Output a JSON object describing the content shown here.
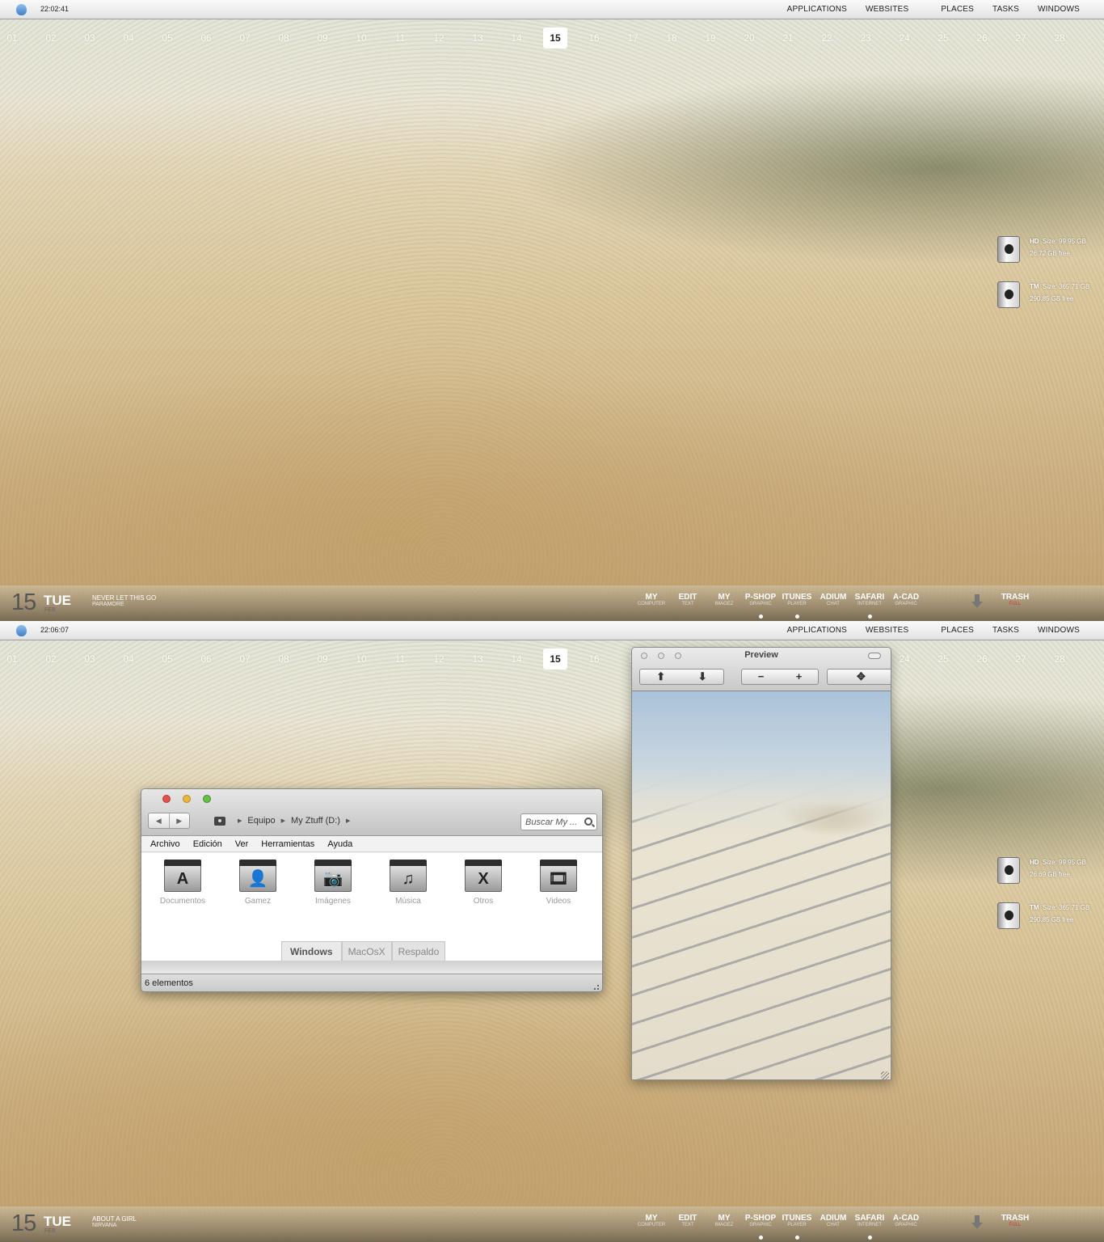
{
  "screens": [
    {
      "clock": "22:02:41",
      "drives": [
        {
          "name": "HD",
          "line1": "Size: 99.95 GB",
          "line2": "26.72 GB free"
        },
        {
          "name": "TM",
          "line1": "Size: 365.71 GB",
          "line2": "290.85 GB free"
        }
      ],
      "now_playing": {
        "song": "NEVER LET THIS GO",
        "artist": "PARAMORE"
      }
    },
    {
      "clock": "22:06:07",
      "drives": [
        {
          "name": "HD",
          "line1": "Size: 99.95 GB",
          "line2": "26.69 GB free"
        },
        {
          "name": "TM",
          "line1": "Size: 365.71 GB",
          "line2": "290.85 GB free"
        }
      ],
      "now_playing": {
        "song": "ABOUT A GIRL",
        "artist": "NIRVANA"
      }
    }
  ],
  "menu": [
    "APPLICATIONS",
    "WEBSITES",
    "PLACES",
    "TASKS",
    "WINDOWS"
  ],
  "days": [
    "01",
    "02",
    "03",
    "04",
    "05",
    "06",
    "07",
    "08",
    "09",
    "10",
    "11",
    "12",
    "13",
    "14",
    "15",
    "16",
    "17",
    "18",
    "19",
    "20",
    "21",
    "22",
    "23",
    "24",
    "25",
    "26",
    "27",
    "28"
  ],
  "today": "15",
  "date": {
    "day": "15",
    "weekday": "TUE",
    "month": "FEB"
  },
  "dock": [
    {
      "label": "MY",
      "sub": "COMPUTER",
      "running": false
    },
    {
      "label": "EDIT",
      "sub": "TEXT",
      "running": false
    },
    {
      "label": "MY",
      "sub": "IMAGEZ",
      "running": false
    },
    {
      "label": "P-SHOP",
      "sub": "GRAPHIC",
      "running": true
    },
    {
      "label": "ITUNES",
      "sub": "PLAYER",
      "running": true
    },
    {
      "label": "ADIUM",
      "sub": "CHAT",
      "running": false
    },
    {
      "label": "SAFARI",
      "sub": "INTERNET",
      "running": true
    },
    {
      "label": "A-CAD",
      "sub": "GRAPHIC",
      "running": false
    }
  ],
  "trash": {
    "label": "TRASH",
    "sub": "FULL"
  },
  "explorer": {
    "breadcrumb": [
      "Equipo",
      "My Ztuff (D:)"
    ],
    "search_placeholder": "Buscar My ...",
    "menu": [
      "Archivo",
      "Edición",
      "Ver",
      "Herramientas",
      "Ayuda"
    ],
    "folders": [
      {
        "label": "Documentos",
        "glyph": "A",
        "icon": "app-store-folder-icon"
      },
      {
        "label": "Gamez",
        "glyph": "👤",
        "icon": "user-folder-icon"
      },
      {
        "label": "Imágenes",
        "glyph": "📷",
        "icon": "camera-folder-icon"
      },
      {
        "label": "Música",
        "glyph": "♫",
        "icon": "music-folder-icon"
      },
      {
        "label": "Otros",
        "glyph": "X",
        "icon": "x-folder-icon"
      },
      {
        "label": "Videos",
        "glyph": "🎞",
        "icon": "film-folder-icon"
      }
    ],
    "tabs": [
      "Windows",
      "MacOsX",
      "Respaldo"
    ],
    "status": "6 elementos"
  },
  "preview": {
    "title": "Preview"
  }
}
